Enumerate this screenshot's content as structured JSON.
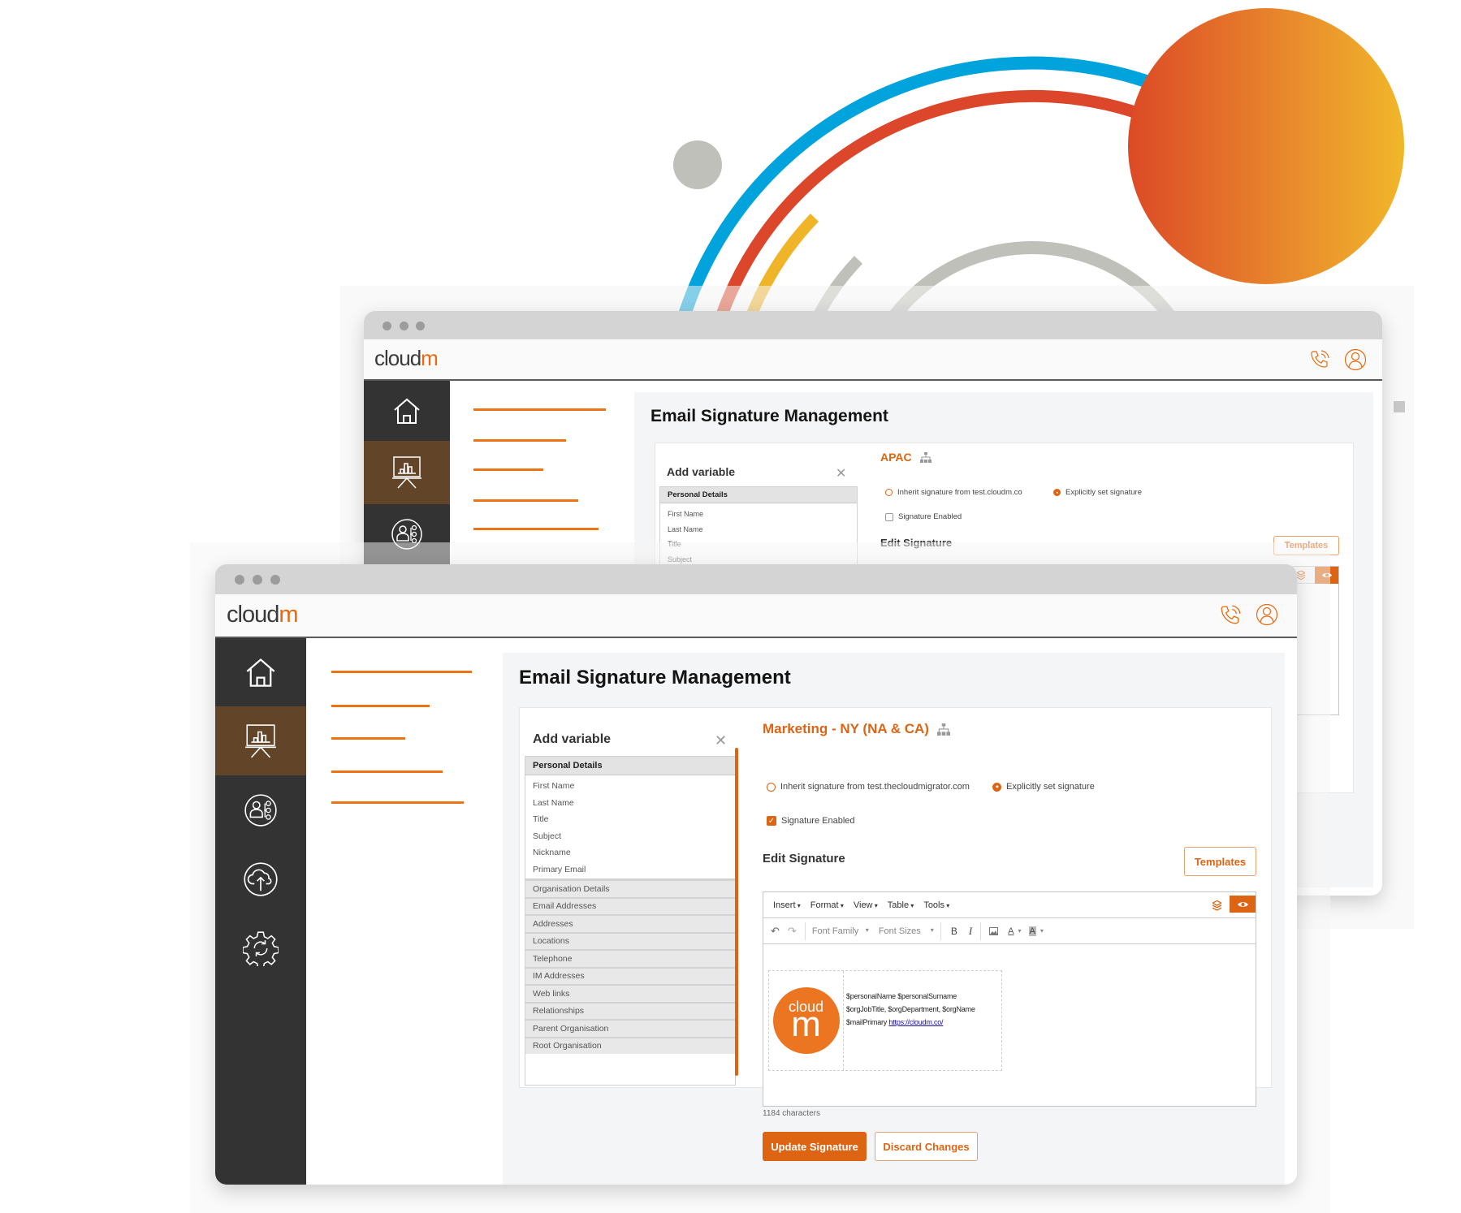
{
  "colors": {
    "accent": "#dd6412",
    "sidebar": "#333333",
    "sidebar_active": "#624428",
    "arc_blue": "#00a3dc",
    "arc_red": "#dc472b",
    "arc_yellow": "#f0b429",
    "arc_grey": "#c0c0bb"
  },
  "logo": {
    "part1": "cloud",
    "part2": "m"
  },
  "back_window": {
    "page_title": "Email Signature Management",
    "add_variable": {
      "heading": "Add variable",
      "section": "Personal Details",
      "items": [
        "First Name",
        "Last Name",
        "Title",
        "Subject"
      ]
    },
    "org_name": "APAC",
    "radio_inherit": "Inherit signature from test.cloudm.co",
    "radio_explicit": "Explicitly set signature",
    "radio_selected": "explicit",
    "checkbox_label": "Signature Enabled",
    "checkbox_checked": false,
    "edit_heading": "Edit Signature",
    "templates_label": "Templates"
  },
  "front_window": {
    "page_title": "Email Signature Management",
    "add_variable": {
      "heading": "Add variable",
      "section": "Personal Details",
      "items": [
        "First Name",
        "Last Name",
        "Title",
        "Subject",
        "Nickname",
        "Primary Email"
      ],
      "sections": [
        "Organisation Details",
        "Email Addresses",
        "Addresses",
        "Locations",
        "Telephone",
        "IM Addresses",
        "Web links",
        "Relationships",
        "Parent Organisation",
        "Root Organisation"
      ]
    },
    "org_name": "Marketing - NY (NA & CA)",
    "radio_inherit": "Inherit signature from test.thecloudmigrator.com",
    "radio_explicit": "Explicitly set signature",
    "radio_selected": "explicit",
    "checkbox_label": "Signature Enabled",
    "checkbox_checked": true,
    "edit_heading": "Edit Signature",
    "templates_label": "Templates",
    "editor": {
      "menus": [
        "Insert",
        "Format",
        "View",
        "Table",
        "Tools"
      ],
      "font_family": "Font Family",
      "font_sizes": "Font Sizes",
      "bold": "B",
      "italic": "I",
      "text_color": "A",
      "highlight": "A",
      "signature": {
        "logo_top": "cloud",
        "logo_bottom": "m",
        "line1": "$personalName $personalSurname",
        "line2": "$orgJobTitle, $orgDepartment, $orgName",
        "line3_prefix": "$mailPrimary",
        "link": "https://cloudm.co/"
      }
    },
    "char_count": "1184 characters",
    "update_label": "Update Signature",
    "discard_label": "Discard Changes"
  }
}
